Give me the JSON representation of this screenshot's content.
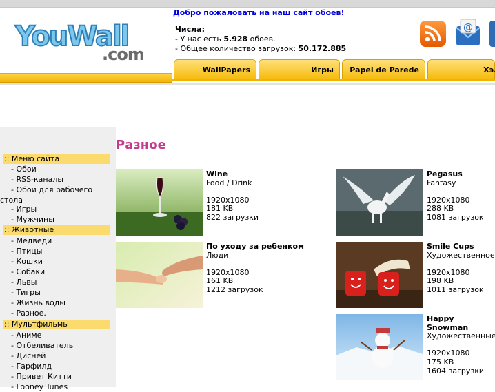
{
  "header": {
    "logo_text": "YouWall",
    "logo_com": ".com",
    "welcome": "Добро пожаловать на наш сайт обоев!",
    "stats_label": "Числа:",
    "stats_line1_prefix": "- У нас есть ",
    "stats_line1_value": "5.928",
    "stats_line1_suffix": " обоев.",
    "stats_line2_prefix": "- Общее количество загрузок: ",
    "stats_line2_value": "50.172.885"
  },
  "nav": {
    "tabs": [
      "WallPapers",
      "Игры",
      "Papel de Parede",
      "Хэллоу"
    ]
  },
  "sidebar": {
    "sections": [
      {
        "title": ":: Меню сайта",
        "items": [
          "- Обои",
          "- RSS-каналы",
          "- Обои для рабочего",
          "стола",
          "- Игры",
          "- Мужчины"
        ]
      },
      {
        "title": ":: Животные",
        "items": [
          "- Медведи",
          "- Птицы",
          "- Кошки",
          "- Собаки",
          "- Львы",
          "- Тигры",
          "- Жизнь воды",
          "- Разное."
        ]
      },
      {
        "title": ":: Мультфильмы",
        "items": [
          "- Аниме",
          "- Отбеливатель",
          "- Дисней",
          "- Гарфилд",
          "- Привет Китти",
          "- Looney Tunes"
        ]
      }
    ]
  },
  "page_title": "Разное",
  "wallpapers": [
    {
      "name": "Wine",
      "category": "Food / Drink",
      "resolution": "1920x1080",
      "size": "181 KB",
      "downloads": "822 загрузки"
    },
    {
      "name": "Pegasus",
      "category": "Fantasy",
      "resolution": "1920x1080",
      "size": "288 KB",
      "downloads": "1081 загрузок"
    },
    {
      "name": "По уходу за ребенком",
      "category": "Люди",
      "resolution": "1920x1080",
      "size": "161 KB",
      "downloads": "1212 загрузок"
    },
    {
      "name": "Smile Cups",
      "category": "Художественное",
      "resolution": "1920x1080",
      "size": "198 KB",
      "downloads": "1011 загрузок"
    },
    {
      "name": "Happy Snowman",
      "category": "Художественные",
      "resolution": "1920x1080",
      "size": "175 KB",
      "downloads": "1604 загрузки"
    }
  ]
}
